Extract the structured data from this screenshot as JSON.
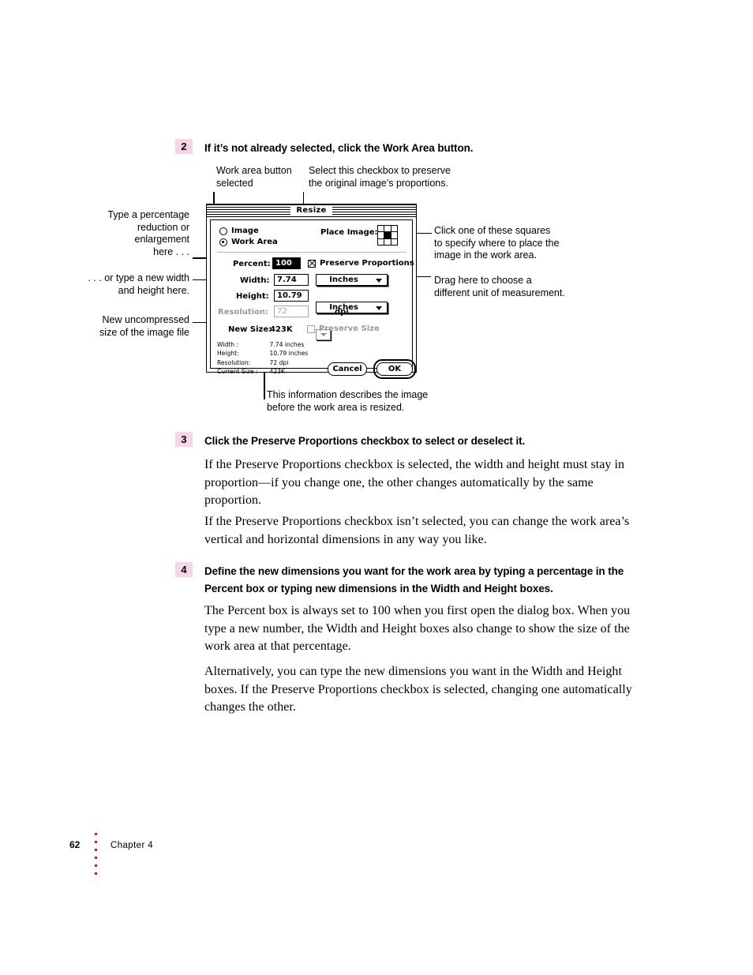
{
  "document": {
    "page_number": "62",
    "chapter": "Chapter 4"
  },
  "steps": [
    {
      "number": "2",
      "heading": "If it’s not already selected, click the Work Area button.",
      "paragraphs": []
    },
    {
      "number": "3",
      "heading": "Click the Preserve Proportions checkbox to select or deselect it.",
      "paragraphs": [
        "If the Preserve Proportions checkbox is selected, the width and height must stay in proportion—if you change one, the other changes automatically by the same proportion.",
        "If the Preserve Proportions checkbox isn’t selected, you can change the work area’s vertical and horizontal dimensions in any way you like."
      ]
    },
    {
      "number": "4",
      "heading": "Define the new dimensions you want for the work area by typing a percentage in the Percent box or typing new dimensions in the Width and Height boxes.",
      "paragraphs": [
        "The Percent box is always set to 100 when you first open the dialog box. When you type a new number, the Width and Height boxes also change to show the size of the work area at that percentage.",
        "Alternatively, you can type the new dimensions you want in the Width and Height boxes. If the Preserve Proportions checkbox is selected, changing one automatically changes the other."
      ]
    }
  ],
  "callouts": {
    "work_area_button": "Work area button\nselected",
    "preserve_checkbox": "Select this checkbox to preserve\nthe original image’s proportions.",
    "percentage": "Type a percentage\nreduction or\nenlargement\nhere . . .",
    "width_height": ". . . or type a new width\nand height here.",
    "new_size": "New uncompressed\nsize of the image file",
    "place_squares": "Click one of these squares\nto specify where to place the\nimage in the work area.",
    "unit_drag": "Drag here to choose a\ndifferent unit of measurement.",
    "info_describes": "This information describes the image\nbefore the work area is resized."
  },
  "dialog": {
    "title": "Resize",
    "radios": [
      {
        "label": "Image",
        "selected": false
      },
      {
        "label": "Work Area",
        "selected": true
      }
    ],
    "place_image_label": "Place Image:",
    "place_grid_selected_index": 4,
    "percent": {
      "label": "Percent:",
      "value": "100",
      "selected": true
    },
    "preserve_proportions": {
      "label": "Preserve Proportions",
      "checked": true
    },
    "width": {
      "label": "Width:",
      "value": "7.74",
      "unit": "Inches"
    },
    "height": {
      "label": "Height:",
      "value": "10.79",
      "unit": "Inches"
    },
    "resolution": {
      "label": "Resolution:",
      "value": "72",
      "unit": "dpi",
      "disabled": true
    },
    "new_size": {
      "label": "New Size:",
      "value": "423K"
    },
    "preserve_size": {
      "label": "Preserve Size",
      "checked": false,
      "disabled": true
    },
    "info": {
      "width_label": "Width :",
      "width_value": "7.74 inches",
      "height_label": "Height:",
      "height_value": "10.79 inches",
      "resolution_label": "Resolution:",
      "resolution_value": "72 dpi",
      "current_size_label": "Current Size :",
      "current_size_value": "423K"
    },
    "buttons": {
      "cancel": "Cancel",
      "ok": "OK"
    }
  },
  "colors": {
    "badge_pink": "#f6d6e6",
    "dot_magenta": "#e8007d"
  }
}
